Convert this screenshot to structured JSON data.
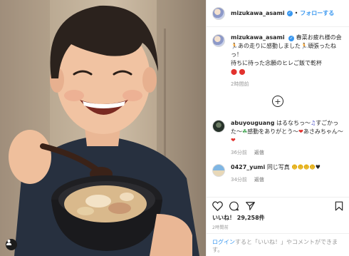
{
  "post": {
    "username": "mizukawa_asami",
    "follow_label": "フォローする",
    "caption_line1": "春菜お疲れ様の会",
    "caption_line2": "あの走りに感動しました",
    "caption_line3": "頑張ったねっ！",
    "caption_line4": "待ちに待った念願のヒレご飯で乾杯",
    "caption_time": "2時間前"
  },
  "comments": [
    {
      "user": "abuyouguang",
      "text_a": "はるなちっ～",
      "text_b": "すごかった～",
      "text_c": "感動をありがとう～",
      "text_d": "あさみちゃん～",
      "time": "36分前",
      "reply_label": "返信"
    },
    {
      "user": "0427_yumi",
      "text": "同じ写真",
      "time": "34分前",
      "reply_label": "返信"
    }
  ],
  "likes": {
    "label": "いいね！",
    "count": "29,258件"
  },
  "date": "2時間前",
  "login": {
    "link": "ログイン",
    "text": "すると「いいね！」やコメントができます。"
  },
  "icons": [
    "heart-icon",
    "comment-icon",
    "share-icon",
    "bookmark-icon",
    "plus-circle-icon",
    "verified-badge-icon",
    "user-tag-icon"
  ],
  "colors": {
    "link": "#3897f0",
    "muted": "#999999",
    "heart": "#e2322e"
  }
}
